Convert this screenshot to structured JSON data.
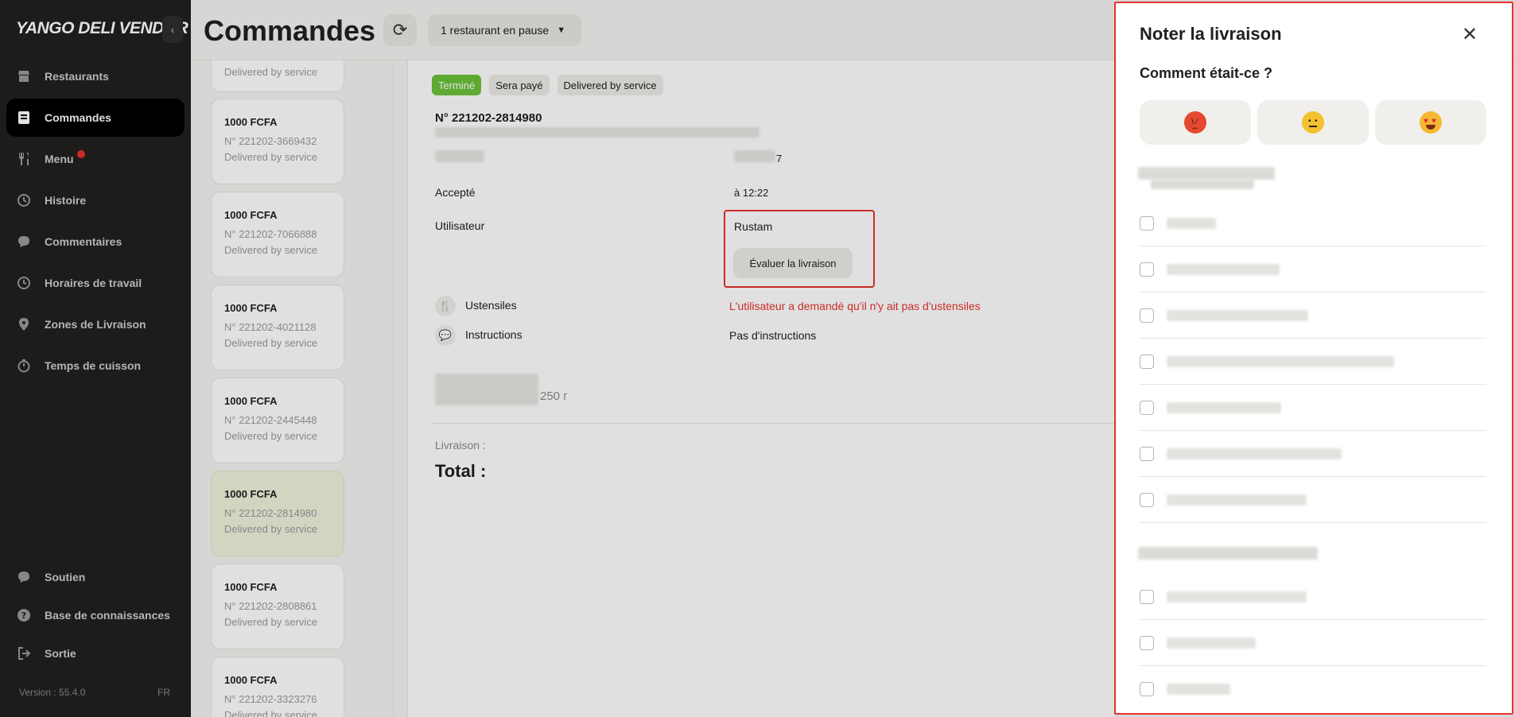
{
  "sidebar": {
    "brand": "YANGO DELI VENDOR",
    "collapse_icon": "chevron-left-icon",
    "items": [
      {
        "label": "Restaurants",
        "icon": "store-icon",
        "active": false
      },
      {
        "label": "Commandes",
        "icon": "orders-icon",
        "active": true
      },
      {
        "label": "Menu",
        "icon": "cutlery-icon",
        "active": false,
        "notification_dot": true
      },
      {
        "label": "Histoire",
        "icon": "history-icon",
        "active": false
      },
      {
        "label": "Commentaires",
        "icon": "comment-icon",
        "active": false
      },
      {
        "label": "Horaires de travail",
        "icon": "clock-icon",
        "active": false
      },
      {
        "label": "Zones de Livraison",
        "icon": "location-pin-icon",
        "active": false
      },
      {
        "label": "Temps de cuisson",
        "icon": "stopwatch-icon",
        "active": false
      }
    ],
    "bottom_items": [
      {
        "label": "Soutien",
        "icon": "chat-icon"
      },
      {
        "label": "Base de connaissances",
        "icon": "help-icon"
      },
      {
        "label": "Sortie",
        "icon": "logout-icon"
      }
    ],
    "version": "Version : 55.4.0",
    "language": "FR"
  },
  "header": {
    "title": "Commandes",
    "refresh_icon": "refresh-icon",
    "pause_button": "1 restaurant en pause"
  },
  "orders": {
    "partial_top": {
      "service": "Delivered by service"
    },
    "cards": [
      {
        "amount": "1000 FCFA",
        "number": "N° 221202-3669432",
        "service": "Delivered by service",
        "selected": false
      },
      {
        "amount": "1000 FCFA",
        "number": "N° 221202-7066888",
        "service": "Delivered by service",
        "selected": false
      },
      {
        "amount": "1000 FCFA",
        "number": "N° 221202-4021128",
        "service": "Delivered by service",
        "selected": false
      },
      {
        "amount": "1000 FCFA",
        "number": "N° 221202-2445448",
        "service": "Delivered by service",
        "selected": false
      },
      {
        "amount": "1000 FCFA",
        "number": "N° 221202-2814980",
        "service": "Delivered by service",
        "selected": true
      },
      {
        "amount": "1000 FCFA",
        "number": "N° 221202-2808861",
        "service": "Delivered by service",
        "selected": false
      },
      {
        "amount": "1000 FCFA",
        "number": "N° 221202-3323276",
        "service": "Delivered by service",
        "selected": false
      }
    ]
  },
  "detail": {
    "badges": [
      "Terminé",
      "Sera payé",
      "Delivered by service"
    ],
    "order_number": "N° 221202-2814980",
    "accepted_label": "Accepté",
    "accepted_value": "à 12:22",
    "partial_value": "7",
    "user_label": "Utilisateur",
    "user_value": "Rustam",
    "rate_button": "Évaluer la livraison",
    "utensils_label": "Ustensiles",
    "utensils_value": "L'utilisateur a demandé qu'il n'y ait pas d'ustensiles",
    "instructions_label": "Instructions",
    "instructions_value": "Pas d'instructions",
    "price_value": "250 г",
    "delivery_label": "Livraison :",
    "total_label": "Total :"
  },
  "rating_panel": {
    "title": "Noter la livraison",
    "close_icon": "close-icon",
    "question": "Comment était-ce ?",
    "emojis": [
      {
        "name": "angry-face-icon"
      },
      {
        "name": "neutral-face-icon"
      },
      {
        "name": "heart-eyes-face-icon"
      }
    ],
    "accent_color": "#e8332e"
  }
}
